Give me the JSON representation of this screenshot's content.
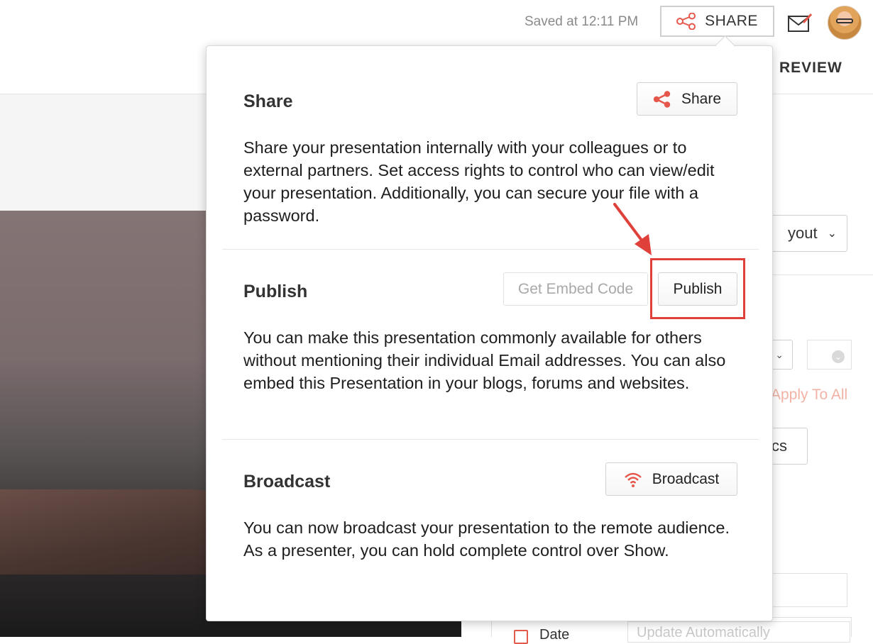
{
  "header": {
    "saved_status": "Saved at 12:11 PM",
    "share_button_label": "SHARE",
    "review_tab_label": "REVIEW",
    "share_icon": "share-icon",
    "mail_icon": "mail-edit-icon"
  },
  "background_panel": {
    "layout_button_label": "yout",
    "apply_to_all_label": "Apply To All",
    "truncated_button_label": "cs",
    "date_label": "Date",
    "update_select_value": "Update Automatically"
  },
  "popover": {
    "share": {
      "title": "Share",
      "button_label": "Share",
      "description": "Share your presentation internally with your colleagues or to external partners. Set access rights to control who can view/edit your presentation. Additionally, you can secure your file with a password."
    },
    "publish": {
      "title": "Publish",
      "embed_button_label": "Get Embed Code",
      "publish_button_label": "Publish",
      "description": "You can make this presentation commonly available for others without mentioning their individual Email addresses. You can also embed this Presentation in your blogs, forums and websites."
    },
    "broadcast": {
      "title": "Broadcast",
      "button_label": "Broadcast",
      "description": "You can now broadcast your presentation to the remote audience. As a presenter, you can hold complete control over Show."
    }
  },
  "colors": {
    "accent_red": "#e0403a",
    "icon_red": "#e4574a"
  }
}
